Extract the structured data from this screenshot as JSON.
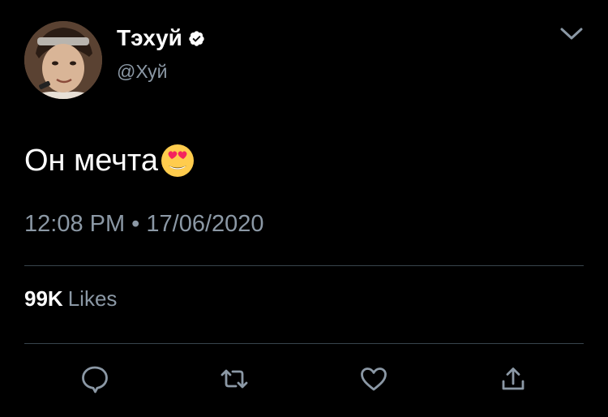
{
  "tweet": {
    "author": {
      "display_name": "Тэхуй",
      "handle": "@Хуй",
      "verified": true,
      "avatar_icon": "profile-photo"
    },
    "text": "Он мечта",
    "emoji": "smiling-face-with-heart-eyes",
    "timestamp": "12:08 PM • 17/06/2020",
    "stats": {
      "likes_count": "99K",
      "likes_label": "Likes"
    },
    "actions": [
      {
        "name": "reply",
        "icon": "speech-bubble-icon"
      },
      {
        "name": "retweet",
        "icon": "retweet-arrows-icon"
      },
      {
        "name": "like",
        "icon": "heart-icon"
      },
      {
        "name": "share",
        "icon": "share-upload-icon"
      }
    ],
    "menu_icon": "chevron-down-icon"
  },
  "colors": {
    "background": "#000000",
    "primary_text": "#ffffff",
    "secondary_text": "#8b98a5",
    "divider": "#38444d",
    "icon": "#8b98a5",
    "verified_badge": "#ffffff"
  }
}
